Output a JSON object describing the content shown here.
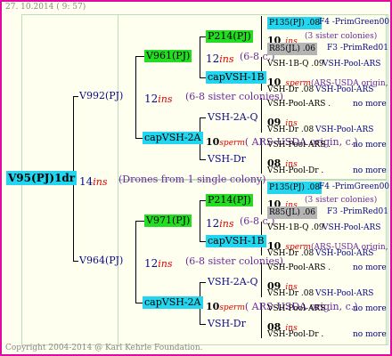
{
  "header": "27. 10.2014 ( 9: 57)",
  "footer": "Copyright 2004-2014 @ Karl Kehrle Foundation.",
  "root": {
    "name": "V95(PJ)1dr",
    "ins_num": "14",
    "ins": "ins",
    "note": "(Drones from 1 single colony)"
  },
  "upper": {
    "name": "V992(PJ)",
    "num": "12",
    "ins": "ins",
    "sisters": "(6-8 sister colonies)",
    "top": {
      "name": "V961(PJ)",
      "num": "12",
      "ins": "ins",
      "sisters": "(6-8 c.)",
      "mother": {
        "name": "P214(PJ)",
        "num": "10",
        "ins": "ins",
        "sisters": "(3 sister colonies)",
        "q": {
          "name": "P135(PJ) .08",
          "suffix": "F4 -PrimGreen00"
        },
        "d": {
          "name": "R85(JL) .06",
          "suffix": "F3 -PrimRed01"
        }
      },
      "drone": {
        "name": "capVSH-1B",
        "num": "10",
        "sperm": "sperm",
        "note": "(ARS-USDA origin, sister",
        "q": {
          "name": "VSH-1B-Q .09",
          "suffix": "VSH-Pool-ARS"
        },
        "d": {
          "name": "VSH-Dr .08",
          "suffix": "VSH-Pool-ARS"
        }
      }
    },
    "bottom": {
      "name": "capVSH-2A",
      "num": "10",
      "sperm": "sperm",
      "note": "( ARS-USDA origin, c.)",
      "mother": {
        "name": "VSH-2A-Q",
        "num": "09",
        "ins": "ins",
        "q": {
          "name": "VSH-Pool-ARS .",
          "more": "no more"
        },
        "d": {
          "name": "VSH-Dr .08",
          "suffix": "VSH-Pool-ARS"
        }
      },
      "drone": {
        "name": "VSH-Dr",
        "num": "08",
        "ins": "ins",
        "q": {
          "name": "VSH-Pool-ARS .",
          "more": "no more"
        },
        "d": {
          "name": "VSH-Pool-Dr .",
          "more": "no more"
        }
      }
    }
  },
  "lower": {
    "name": "V964(PJ)",
    "num": "12",
    "ins": "ins",
    "sisters": "(6-8 sister colonies)",
    "top": {
      "name": "V971(PJ)",
      "num": "12",
      "ins": "ins",
      "sisters": "(6-8 c.)",
      "mother": {
        "name": "P214(PJ)",
        "num": "10",
        "ins": "ins",
        "sisters": "(3 sister colonies)",
        "q": {
          "name": "P135(PJ) .08",
          "suffix": "F4 -PrimGreen00"
        },
        "d": {
          "name": "R85(JL) .06",
          "suffix": "F3 -PrimRed01"
        }
      },
      "drone": {
        "name": "capVSH-1B",
        "num": "10",
        "sperm": "sperm",
        "note": "(ARS-USDA origin, sister",
        "q": {
          "name": "VSH-1B-Q .09",
          "suffix": "VSH-Pool-ARS"
        },
        "d": {
          "name": "VSH-Dr .08",
          "suffix": "VSH-Pool-ARS"
        }
      }
    },
    "bottom": {
      "name": "capVSH-2A",
      "num": "10",
      "sperm": "sperm",
      "note": "( ARS-USDA origin, c.)",
      "mother": {
        "name": "VSH-2A-Q",
        "num": "09",
        "ins": "ins",
        "q": {
          "name": "VSH-Pool-ARS .",
          "more": "no more"
        },
        "d": {
          "name": "VSH-Dr .08",
          "suffix": "VSH-Pool-ARS"
        }
      },
      "drone": {
        "name": "VSH-Dr",
        "num": "08",
        "ins": "ins",
        "q": {
          "name": "VSH-Pool-ARS .",
          "more": "no more"
        },
        "d": {
          "name": "VSH-Pool-Dr .",
          "more": "no more"
        }
      }
    }
  }
}
